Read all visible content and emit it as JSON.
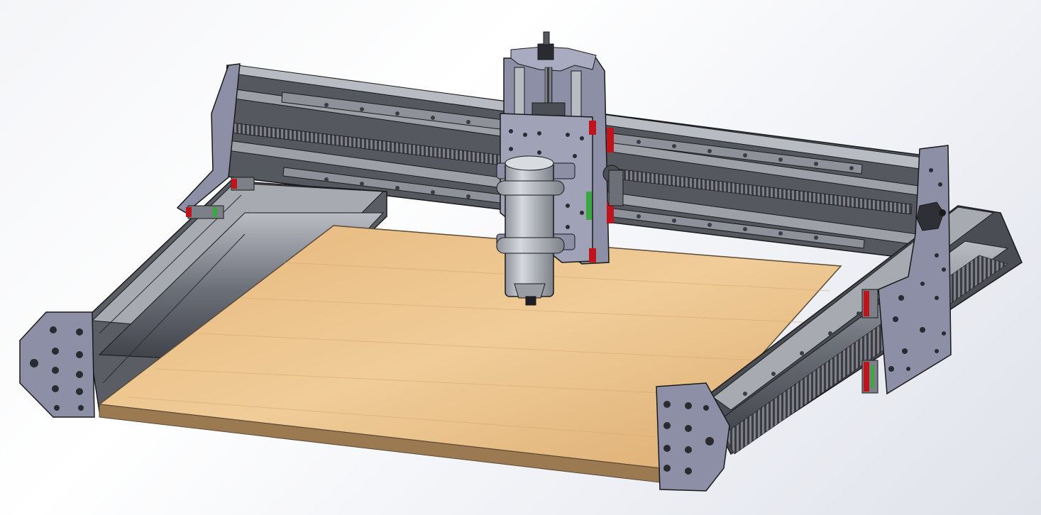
{
  "scene": {
    "subject": "cnc-router-3d-model",
    "colors": {
      "background_light": "#ffffff",
      "background_dark": "#dfe2ea",
      "aluminum_dark": "#4a4d54",
      "aluminum_mid": "#7a7e87",
      "aluminum_light": "#b8bbc2",
      "plate": "#8c8fa6",
      "plate_light": "#a9acc0",
      "rail": "#9a9da4",
      "carriage_red": "#c0141c",
      "carriage_green": "#3aa843",
      "spindle": "#b9bcc2",
      "wood_light": "#e9c18c",
      "wood_dark": "#cf9a5e",
      "wood_edge": "#8a6a45",
      "outline": "#1a1a1a"
    },
    "icons": [
      "spindle-motor-icon",
      "stepper-motor-icon",
      "lead-screw-icon"
    ]
  }
}
